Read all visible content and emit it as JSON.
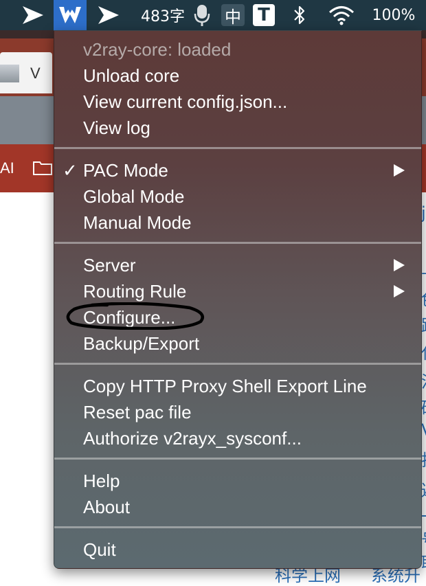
{
  "menubar": {
    "input_count": "483字",
    "ime_label": "中",
    "t_label": "T",
    "battery": "100%"
  },
  "background": {
    "tab_letter": "V",
    "bookmark_text": "AI",
    "footer_left": "科学上网",
    "footer_right": "系统升",
    "side_glyphs": [
      "jo",
      "上",
      "色",
      "路",
      "代",
      "沉",
      "硅",
      "V",
      "排",
      "避",
      "一",
      "号",
      "职"
    ]
  },
  "menu": {
    "status": "v2ray-core: loaded",
    "unload_core": "Unload core",
    "view_config": "View current config.json...",
    "view_log": "View log",
    "check_glyph": "✓",
    "pac_mode": "PAC Mode",
    "global_mode": "Global Mode",
    "manual_mode": "Manual Mode",
    "server": "Server",
    "routing_rule": "Routing Rule",
    "configure": "Configure...",
    "backup_export": "Backup/Export",
    "copy_http_proxy": "Copy HTTP Proxy Shell Export Line",
    "reset_pac": "Reset pac file",
    "authorize": "Authorize v2rayx_sysconf...",
    "help": "Help",
    "about": "About",
    "quit": "Quit"
  },
  "icons": {
    "menubar": [
      "send-arrow-icon",
      "v2rayx-icon",
      "send-arrow-icon",
      "microphone-icon",
      "bluetooth-icon",
      "wifi-icon"
    ],
    "background": [
      "folder-icon"
    ],
    "menu": [
      "checkmark-icon",
      "submenu-arrow-icon"
    ]
  },
  "colors": {
    "menubar_bg": "#1f3743",
    "v2rayx_active_bg": "#2d6ec9",
    "browser_accent": "#a23628",
    "link_blue": "#2a6fb8"
  }
}
